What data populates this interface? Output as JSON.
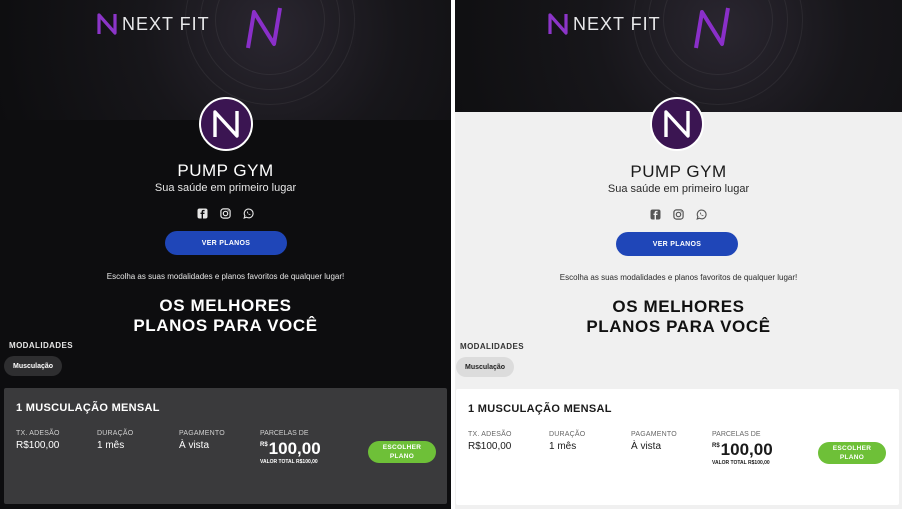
{
  "brand": {
    "name": "NEXT FIT"
  },
  "gym": {
    "name": "PUMP GYM",
    "tagline": "Sua saúde em primeiro lugar",
    "socials": [
      "facebook-icon",
      "instagram-icon",
      "whatsapp-icon"
    ]
  },
  "cta": {
    "view_plans": "VER PLANOS"
  },
  "intro": "Escolha as suas modalidades e planos favoritos de qualquer lugar!",
  "headline": {
    "line1": "OS MELHORES",
    "line2": "PLANOS PARA VOCÊ"
  },
  "modalities": {
    "title": "MODALIDADES",
    "items": [
      "Musculação"
    ]
  },
  "plan": {
    "title": "1 MUSCULAÇÃO MENSAL",
    "fields": [
      {
        "label": "TX. ADESÃO",
        "value": "R$100,00"
      },
      {
        "label": "DURAÇÃO",
        "value": "1 mês"
      },
      {
        "label": "PAGAMENTO",
        "value": "À vista"
      }
    ],
    "installments_label": "PARCELAS DE",
    "currency": "R$",
    "amount": "100,00",
    "total_label": "VALOR TOTAL",
    "total_value": "R$100,00",
    "choose_label_1": "ESCOLHER",
    "choose_label_2": "PLANO"
  },
  "colors": {
    "dark_bg": "#0d0d0f",
    "light_bg": "#f0f0f0",
    "brand_purple": "#3b1552",
    "neon_purple": "#9b3bd6",
    "button_blue": "#1f46b8",
    "button_green": "#6ec038"
  }
}
